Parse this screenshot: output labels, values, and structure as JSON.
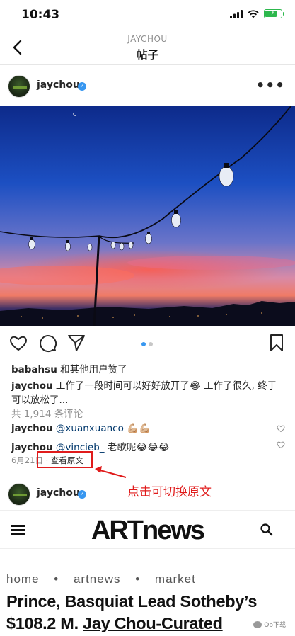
{
  "status_bar": {
    "time": "10:43"
  },
  "nav": {
    "subtitle": "JAYCHOU",
    "title": "帖子"
  },
  "post": {
    "username": "jaychou",
    "likes_user": "babahsu",
    "likes_suffix": " 和其他用户赞了",
    "caption_line1": " 工作了一段时间可以好好放开了😂 工作了很久, 终于",
    "caption_line2": "可以放松了...",
    "comments_count": "共 1,914 条评论",
    "comments": [
      {
        "user": "jaychou",
        "mention": "@xuanxuanco",
        "text": " 💪🏼💪🏼"
      },
      {
        "user": "jaychou",
        "mention": "@vincieb_",
        "text": " 老歌呢😂😂😂"
      }
    ],
    "date": "6月21日",
    "separator": " · ",
    "view_original": "查看原文"
  },
  "annotation": "点击可切换原文",
  "next_post": {
    "username": "jaychou"
  },
  "artnews": {
    "logo": "ARTnews",
    "breadcrumb": [
      "home",
      "artnews",
      "market"
    ],
    "breadcrumb_sep": "•",
    "headline_1": "Prince, Basquiat Lead Sotheby’s",
    "headline_2": "$108.2 M. ",
    "headline_3": "Jay Chou-Curated"
  },
  "watermark": "Ob下载",
  "colors": {
    "accent_red": "#e01b1b",
    "verified_blue": "#3897f0",
    "battery_green": "#2db84d"
  },
  "battery_level": 0.75
}
